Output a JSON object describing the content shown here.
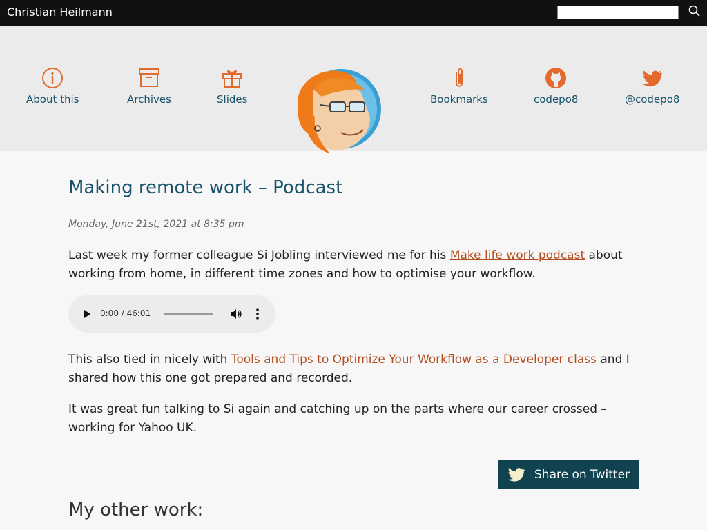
{
  "topbar": {
    "site_title": "Christian Heilmann",
    "search_placeholder": ""
  },
  "nav": {
    "about": "About this",
    "archives": "Archives",
    "slides": "Slides",
    "bookmarks": "Bookmarks",
    "github": "codepo8",
    "twitter": "@codepo8"
  },
  "colors": {
    "accent": "#e36a2d",
    "link": "#16536b",
    "inline_link": "#b44d1e",
    "share_bg": "#11424f"
  },
  "post": {
    "title": "Making remote work – Podcast",
    "date": "Monday, June 21st, 2021 at 8:35 pm",
    "p1_before": "Last week my former colleague Si Jobling interviewed me for his ",
    "p1_link": "Make life work podcast",
    "p1_after": " about working from home, in different time zones and how to optimise your workflow.",
    "audio_time": "0:00 / 46:01",
    "p2_before": "This also tied in nicely with ",
    "p2_link": "Tools and Tips to Optimize Your Workflow as a Developer class",
    "p2_after": " and I shared how this one got prepared and recorded.",
    "p3": "It was great fun talking to Si again and catching up on the parts where our career crossed – working for Yahoo UK.",
    "share_label": "Share on Twitter",
    "other_work_heading": "My other work:"
  }
}
